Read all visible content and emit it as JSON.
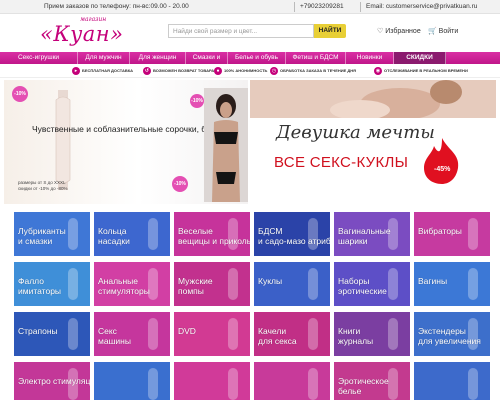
{
  "topbar": {
    "orders": "Прием заказов по телефону: пн-вс:09.00 - 20.00",
    "phone": "+79023209281",
    "email": "Email: customerservice@privatkuan.ru"
  },
  "header": {
    "logo_small": "магазин",
    "logo_big": "«Куан»",
    "search_placeholder": "Найди свой размер и цвет...",
    "search_button": "НАЙТИ",
    "favorites": "Избранное",
    "login": "Войти"
  },
  "nav": {
    "items": [
      {
        "label": "Секс-игрушки"
      },
      {
        "label": "Для мужчин"
      },
      {
        "label": "Для женщин"
      },
      {
        "label": "Смазки и"
      },
      {
        "label": "Белье и обувь"
      },
      {
        "label": "Фетиш и БДСМ"
      },
      {
        "label": "Новинки"
      },
      {
        "label": "СКИДКИ"
      }
    ]
  },
  "features": [
    {
      "label": "бесплатная доставка",
      "icon": "truck-icon"
    },
    {
      "label": "возможен возврат товара",
      "icon": "return-icon"
    },
    {
      "label": "100% анонимность",
      "icon": "lock-icon"
    },
    {
      "label": "обработка заказа в течение дня",
      "icon": "clock-icon"
    },
    {
      "label": "отслеживание в реальном времени",
      "icon": "location-icon"
    }
  ],
  "banner_left": {
    "badge1": "-10%",
    "badge2": "-10%",
    "badge3": "-10%",
    "tagline": "Чувственные и соблазнительные сорочки, боди",
    "sizes_line1": "размеры от S до XXXL",
    "sizes_line2": "скидки от -10% до -80%"
  },
  "banner_right": {
    "title": "Девушка мечты",
    "subtitle": "ВСЕ СЕКС-КУКЛЫ",
    "discount": "-45%"
  },
  "categories": [
    {
      "label1": "Лубриканты",
      "label2": "и смазки",
      "color": "#3f77d6"
    },
    {
      "label1": "Кольца",
      "label2": "насадки",
      "color": "#3d67cf"
    },
    {
      "label1": "Веселые",
      "label2": "вещицы и приколы",
      "color": "#c6339b"
    },
    {
      "label1": "БДСМ",
      "label2": "и садо-мазо атрибуты",
      "color": "#2b43a8"
    },
    {
      "label1": "Вагинальные",
      "label2": "шарики",
      "color": "#7b4cc1"
    },
    {
      "label1": "Вибраторы",
      "label2": "",
      "color": "#c63aa0"
    },
    {
      "label1": "Фалло",
      "label2": "имитаторы",
      "color": "#3f8fd8"
    },
    {
      "label1": "Анальные",
      "label2": "стимуляторы",
      "color": "#d23fa4"
    },
    {
      "label1": "Мужские",
      "label2": "помпы",
      "color": "#c2318e"
    },
    {
      "label1": "Куклы",
      "label2": "",
      "color": "#3b60c8"
    },
    {
      "label1": "Наборы",
      "label2": "эротические",
      "color": "#5d4fc7"
    },
    {
      "label1": "Вагины",
      "label2": "",
      "color": "#3c78d6"
    },
    {
      "label1": "Страпоны",
      "label2": "",
      "color": "#2d57b8"
    },
    {
      "label1": "Секс",
      "label2": "машины",
      "color": "#c5369d"
    },
    {
      "label1": "DVD",
      "label2": "",
      "color": "#d23a93"
    },
    {
      "label1": "Качели",
      "label2": "для секса",
      "color": "#c12f86"
    },
    {
      "label1": "Книги",
      "label2": "журналы",
      "color": "#7b3ea1"
    },
    {
      "label1": "Экстендеры",
      "label2": "для увеличения",
      "color": "#3d6fcb"
    },
    {
      "label1": "Электро стимуляция",
      "label2": "",
      "color": "#c33798"
    },
    {
      "label1": "",
      "label2": "",
      "color": "#3a6fcf"
    },
    {
      "label1": "",
      "label2": "",
      "color": "#d13a99"
    },
    {
      "label1": "",
      "label2": "",
      "color": "#c83a9a"
    },
    {
      "label1": "Эротическое",
      "label2": "белье",
      "color": "#c33a8f"
    },
    {
      "label1": "",
      "label2": "",
      "color": "#3d6acb"
    }
  ]
}
